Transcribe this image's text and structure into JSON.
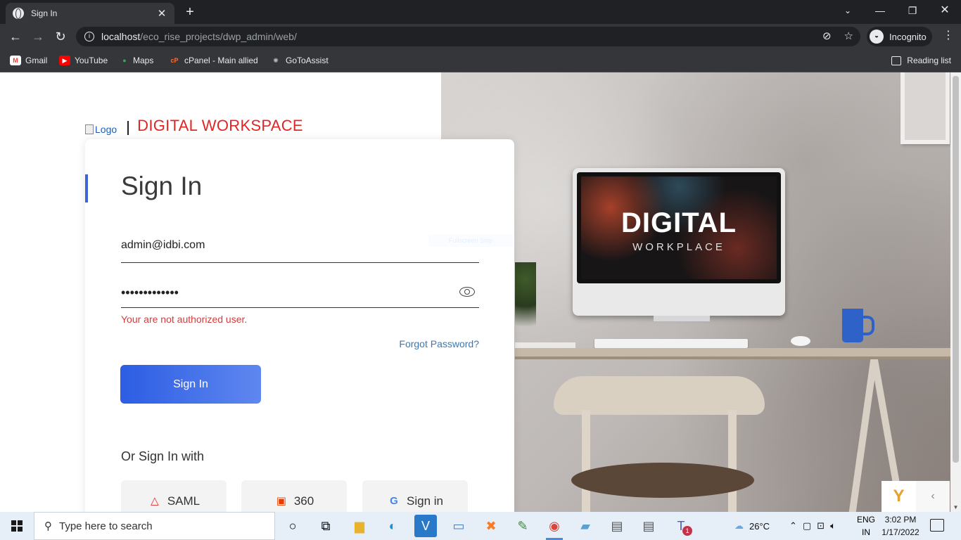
{
  "browser": {
    "tab_title": "Sign In",
    "url_host": "localhost",
    "url_path": "/eco_rise_projects/dwp_admin/web/",
    "incognito_label": "Incognito",
    "bookmarks": [
      "Gmail",
      "YouTube",
      "Maps",
      "cPanel - Main allied",
      "GoToAssist"
    ],
    "reading_list": "Reading list"
  },
  "header": {
    "logo_alt": "Logo",
    "brand": "DIGITAL WORKSPACE"
  },
  "form": {
    "title": "Sign In",
    "email_value": "admin@idbi.com",
    "password_value": "•••••••••••••",
    "error": "Your are not authorized user.",
    "forgot": "Forgot Password?",
    "submit_label": "Sign In",
    "alt_title": "Or Sign In with",
    "sso": [
      {
        "label": "SAML",
        "icon": "saml-icon"
      },
      {
        "label": "360",
        "icon": "office-icon"
      },
      {
        "label": "Sign in",
        "icon": "google-icon"
      }
    ]
  },
  "hero": {
    "word1": "DIGITAL",
    "word2": "WORKPLACE",
    "ghost_text": "Fullscreen Snip"
  },
  "taskbar": {
    "search_placeholder": "Type here to search",
    "weather": "26°C",
    "lang1": "ENG",
    "lang2": "IN",
    "time": "3:02 PM",
    "date": "1/17/2022",
    "teams_badge": "1"
  },
  "colors": {
    "brand_red": "#e12626",
    "accent_blue": "#3e64d6",
    "error_red": "#d63b3b",
    "link_blue": "#3a78b5"
  }
}
